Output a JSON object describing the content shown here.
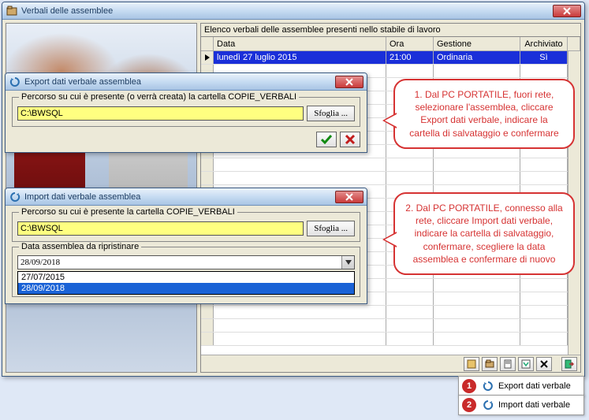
{
  "main": {
    "title": "Verbali delle assemblee",
    "table_caption": "Elenco verbali delle assemblee presenti nello stabile di lavoro",
    "columns": {
      "data": "Data",
      "ora": "Ora",
      "gestione": "Gestione",
      "archiviato": "Archiviato"
    },
    "rows": [
      {
        "data": "lunedì 27 luglio 2015",
        "ora": "21:00",
        "gestione": "Ordinaria",
        "archiviato": "Sì"
      }
    ]
  },
  "export": {
    "title": "Export dati verbale assemblea",
    "group_label": "Percorso su cui è presente (o verrà creata) la cartella COPIE_VERBALI",
    "path": "C:\\BWSQL",
    "browse": "Sfoglia ..."
  },
  "import": {
    "title": "Import dati verbale assemblea",
    "group1_label": "Percorso su cui è presente la cartella COPIE_VERBALI",
    "path": "C:\\BWSQL",
    "browse": "Sfoglia ...",
    "group2_label": "Data assemblea da ripristinare",
    "selected": "28/09/2018",
    "options": [
      "27/07/2015",
      "28/09/2018"
    ]
  },
  "callouts": {
    "c1": "1. Dal PC PORTATILE, fuori rete, selezionare l'assemblea, cliccare Export dati verbale, indicare la cartella di salvataggio e confermare",
    "c2": "2. Dal PC PORTATILE, connesso alla rete, cliccare Import dati verbale, indicare la cartella di salvataggio, confermare, scegliere la data assemblea e confermare di nuovo"
  },
  "menu": {
    "b1": "1",
    "b2": "2",
    "export_label": "Export dati verbale",
    "import_label": "Import dati verbale"
  }
}
